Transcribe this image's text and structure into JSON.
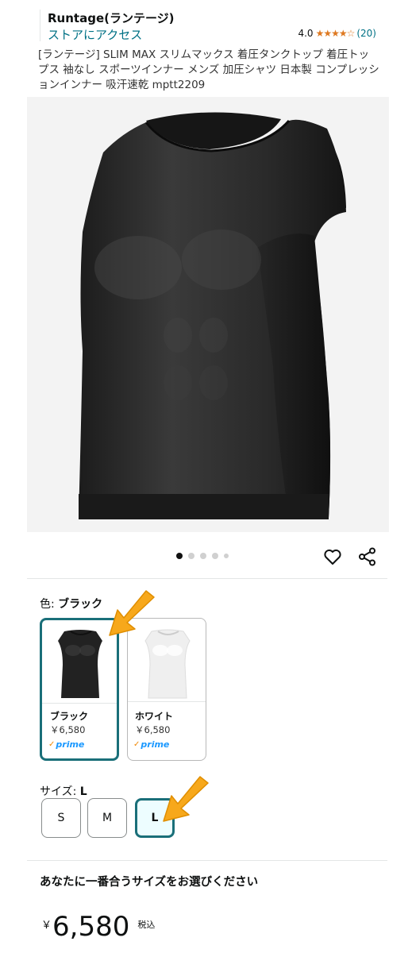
{
  "store": {
    "brand": "Runtage(ランテージ)",
    "store_link": "ストアにアクセス",
    "rating": "4.0",
    "stars": "★★★★☆",
    "rating_count": "(20)"
  },
  "product": {
    "title": "[ランテージ] SLIM MAX スリムマックス 着圧タンクトップ 着圧トップス 袖なし スポーツインナー メンズ 加圧シャツ 日本製 コンプレッションインナー 吸汗速乾 mptt2209"
  },
  "gallery": {
    "image_count": 5,
    "active_index": 0
  },
  "color": {
    "label": "色: ",
    "selected": "ブラック",
    "options": [
      {
        "name": "ブラック",
        "price": "￥6,580",
        "prime": "prime"
      },
      {
        "name": "ホワイト",
        "price": "￥6,580",
        "prime": "prime"
      }
    ]
  },
  "size": {
    "label": "サイズ: ",
    "selected": "L",
    "options": [
      "S",
      "M",
      "L"
    ]
  },
  "size_prompt": "あなたに一番合うサイズをお選びください",
  "price": {
    "symbol": "￥",
    "amount": "6,580",
    "tax_note": "税込"
  },
  "colors": {
    "link": "#007185",
    "star": "#de7921",
    "selected_border": "#1a6f79",
    "prime": "#1a98ff",
    "annotation_arrow": "#f7a81b"
  }
}
